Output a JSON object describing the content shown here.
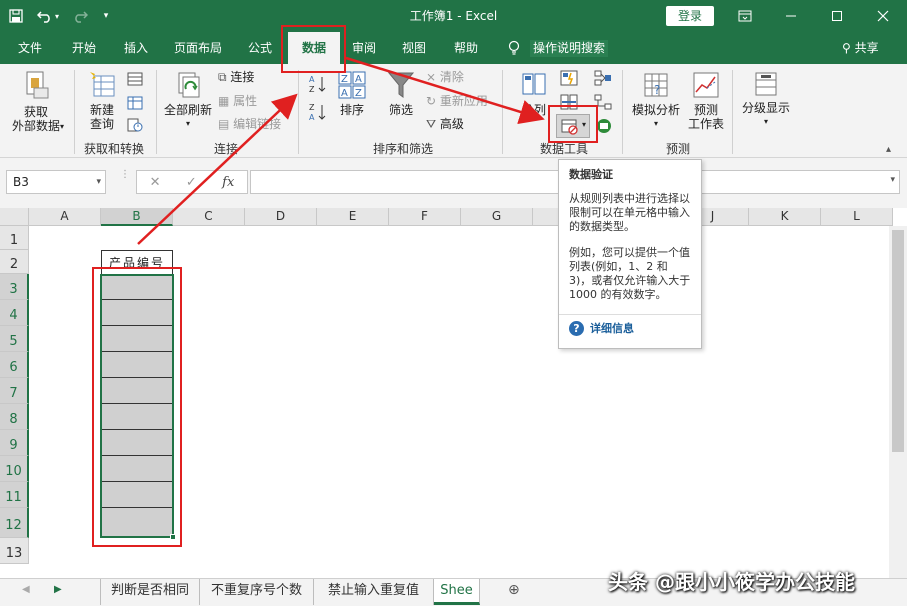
{
  "window": {
    "title": "工作簿1  -  Excel",
    "login_label": "登录"
  },
  "tabs": [
    {
      "label": "文件"
    },
    {
      "label": "开始"
    },
    {
      "label": "插入"
    },
    {
      "label": "页面布局"
    },
    {
      "label": "公式"
    },
    {
      "label": "数据"
    },
    {
      "label": "审阅"
    },
    {
      "label": "视图"
    },
    {
      "label": "帮助"
    }
  ],
  "tell_me": "操作说明搜索",
  "share_label": "共享",
  "ribbon": {
    "get_external": "获取\n外部数据",
    "new_query": "新建\n查询",
    "group_get": "获取和转换",
    "refresh_all": "全部刷新",
    "connections": "连接",
    "properties": "属性",
    "edit_links": "编辑链接",
    "group_connections": "连接",
    "sort": "排序",
    "filter": "筛选",
    "clear": "清除",
    "reapply": "重新应用",
    "advanced": "高级",
    "group_sort": "排序和筛选",
    "text_to_columns": "分列",
    "group_data_tools": "数据工具",
    "what_if": "模拟分析",
    "forecast_sheet": "预测\n工作表",
    "group_forecast": "预测",
    "outline": "分级显示"
  },
  "formula_bar": {
    "name_box": "B3",
    "fx": "fx",
    "cancel": "✕",
    "enter": "✓"
  },
  "grid": {
    "columns": [
      "A",
      "B",
      "C",
      "D",
      "E",
      "F",
      "G",
      "H",
      "I",
      "J",
      "K",
      "L"
    ],
    "rows": [
      "1",
      "2",
      "3",
      "4",
      "5",
      "6",
      "7",
      "8",
      "9",
      "10",
      "11",
      "12",
      "13"
    ],
    "header_cell": "产品编号"
  },
  "tooltip": {
    "title": "数据验证",
    "para1": "从规则列表中进行选择以限制可以在单元格中输入的数据类型。",
    "para2": "例如，您可以提供一个值列表(例如，1、2 和 3)，或者仅允许输入大于 1000 的有效数字。",
    "more": "详细信息"
  },
  "sheets": [
    {
      "label": "判断是否相同"
    },
    {
      "label": "不重复序号个数"
    },
    {
      "label": "禁止输入重复值"
    },
    {
      "label": "Shee"
    }
  ],
  "watermark": "头条 @跟小小筱学办公技能",
  "colors": {
    "brand": "#217346",
    "annotation": "#e02020"
  }
}
